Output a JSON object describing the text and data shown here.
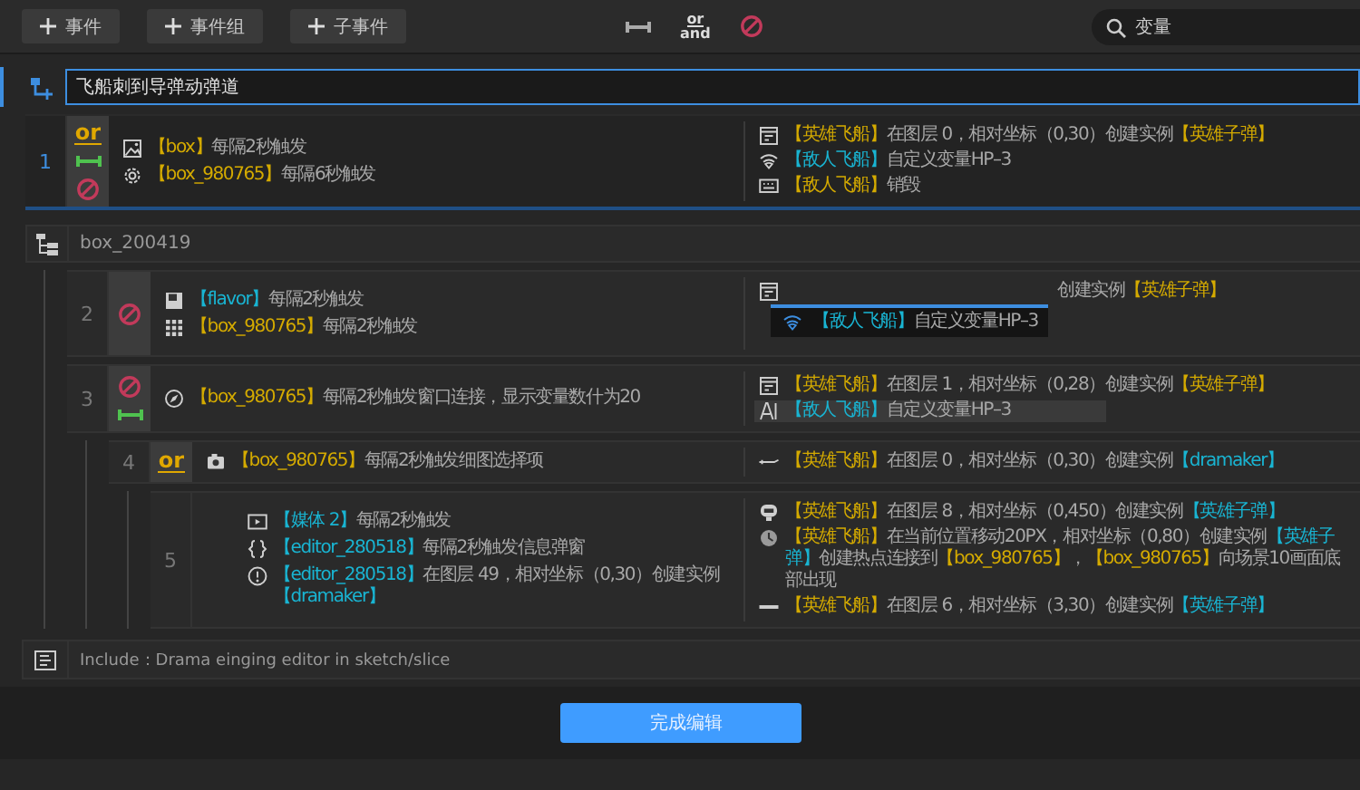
{
  "toolbar": {
    "buttons": [
      {
        "label": "事件"
      },
      {
        "label": "事件组"
      },
      {
        "label": "子事件"
      }
    ],
    "logic_label": "or",
    "logic_label_2": "and",
    "search": {
      "value": "变量"
    }
  },
  "title_field": {
    "value": "飞船刺到导弹动弹道"
  },
  "events": [
    {
      "number": "1",
      "selected": true,
      "markers": [
        {
          "kind": "or",
          "text": "or"
        },
        {
          "kind": "link"
        },
        {
          "kind": "disabled"
        }
      ],
      "conditions": [
        {
          "parts": [
            {
              "text": "【box】",
              "color": "#d4aa00"
            },
            {
              "text": "每隔2秒触发"
            }
          ]
        },
        {
          "parts": [
            {
              "text": "【box_980765】",
              "color": "#d4aa00"
            },
            {
              "text": "每隔6秒触发"
            }
          ]
        }
      ],
      "actions": [
        {
          "selected": false,
          "parts": [
            {
              "text": "【英雄飞船】",
              "color": "#d4aa00"
            },
            {
              "text": "在图层 0，相对坐标（0,30）创建实例"
            },
            {
              "text": "【英雄子弹】",
              "color": "#d4aa00"
            }
          ]
        },
        {
          "selected": false,
          "parts": [
            {
              "text": "【敌人飞船】",
              "color": "#19b4d2"
            },
            {
              "text": "自定义变量HP–3"
            }
          ]
        },
        {
          "selected": false,
          "parts": [
            {
              "text": "【敌人飞船】",
              "color": "#d4aa00"
            },
            {
              "text": "销毁"
            }
          ]
        }
      ]
    }
  ],
  "group": {
    "title": "box_200419",
    "children": [
      {
        "number": "2",
        "selected": false,
        "markers": [
          {
            "kind": "disabled"
          }
        ],
        "conditions": [
          {
            "parts": [
              {
                "text": "【flavor】",
                "color": "#19b4d2"
              },
              {
                "text": "每隔2秒触发"
              }
            ]
          },
          {
            "parts": [
              {
                "text": "【box_980765】",
                "color": "#d4aa00"
              },
              {
                "text": "每隔2秒触发"
              }
            ]
          }
        ],
        "actions": [
          {
            "selected": false,
            "parts": [
              {
                "text": "创建实例"
              },
              {
                "text": "【英雄子弹】",
                "color": "#d4aa00"
              }
            ]
          }
        ],
        "drag_ghost": {
          "parts": [
            {
              "text": "【敌人飞船】",
              "color": "#19b4d2"
            },
            {
              "text": "自定义变量HP–3"
            }
          ]
        }
      },
      {
        "number": "3",
        "selected": false,
        "markers": [
          {
            "kind": "disabled"
          },
          {
            "kind": "link"
          }
        ],
        "conditions": [
          {
            "parts": [
              {
                "text": "【box_980765】",
                "color": "#d4aa00"
              },
              {
                "text": "每隔2秒触发窗口连接，显示变量数什为20"
              }
            ]
          }
        ],
        "actions": [
          {
            "selected": false,
            "parts": [
              {
                "text": "【英雄飞船】",
                "color": "#d4aa00"
              },
              {
                "text": "在图层 1，相对坐标（0,28）创建实例"
              },
              {
                "text": "【英雄子弹】",
                "color": "#d4aa00"
              }
            ]
          },
          {
            "selected": true,
            "parts": [
              {
                "text": "【敌人飞船】",
                "color": "#19b4d2"
              },
              {
                "text": "自定义变量HP–3"
              }
            ]
          }
        ],
        "children": [
          {
            "number": "4",
            "selected": false,
            "markers": [
              {
                "kind": "or",
                "text": "or"
              }
            ],
            "conditions": [
              {
                "parts": [
                  {
                    "text": "【box_980765】",
                    "color": "#d4aa00"
                  },
                  {
                    "text": "每隔2秒触发细图选择项"
                  }
                ]
              }
            ],
            "actions": [
              {
                "selected": false,
                "parts": [
                  {
                    "text": "【英雄飞船】",
                    "color": "#d4aa00"
                  },
                  {
                    "text": "在图层 0，相对坐标（0,30）创建实例"
                  },
                  {
                    "text": "【dramaker】",
                    "color": "#19b4d2"
                  }
                ]
              }
            ],
            "children": [
              {
                "number": "5",
                "selected": false,
                "conditions": [
                  {
                    "parts": [
                      {
                        "text": "【媒体 2】",
                        "color": "#19b4d2"
                      },
                      {
                        "text": "每隔2秒触发"
                      }
                    ]
                  },
                  {
                    "parts": [
                      {
                        "text": "【editor_280518】",
                        "color": "#19b4d2"
                      },
                      {
                        "text": "每隔2秒触发信息弹窗"
                      }
                    ]
                  },
                  {
                    "parts": [
                      {
                        "text": "【editor_280518】",
                        "color": "#19b4d2"
                      },
                      {
                        "text": "在图层 49，相对坐标（0,30）创建实例"
                      },
                      {
                        "text": "【dramaker】",
                        "color": "#19b4d2"
                      }
                    ]
                  }
                ],
                "actions": [
                  {
                    "selected": false,
                    "parts": [
                      {
                        "text": "【英雄飞船】",
                        "color": "#d4aa00"
                      },
                      {
                        "text": "在图层 8，相对坐标（0,450）创建实例"
                      },
                      {
                        "text": "【英雄子弹】",
                        "color": "#19b4d2"
                      }
                    ]
                  },
                  {
                    "selected": false,
                    "parts": [
                      {
                        "text": "【英雄飞船】",
                        "color": "#d4aa00"
                      },
                      {
                        "text": "在当前位置移动20PX，相对坐标（0,80）创建实例"
                      },
                      {
                        "text": "【英雄子弹】",
                        "color": "#19b4d2"
                      },
                      {
                        "text": "创建热点连接到"
                      },
                      {
                        "text": "【box_980765】",
                        "color": "#d4aa00"
                      },
                      {
                        "text": "，"
                      },
                      {
                        "text": "【box_980765】",
                        "color": "#d4aa00"
                      },
                      {
                        "text": "向场景10画面底部出现"
                      }
                    ]
                  },
                  {
                    "selected": false,
                    "parts": [
                      {
                        "text": "【英雄飞船】",
                        "color": "#d4aa00"
                      },
                      {
                        "text": "在图层 6，相对坐标（3,30）创建实例"
                      },
                      {
                        "text": "【英雄子弹】",
                        "color": "#19b4d2"
                      }
                    ]
                  }
                ]
              }
            ]
          }
        ]
      }
    ]
  },
  "include": {
    "text": "Include：Drama einging editor in sketch/slice"
  },
  "footer": {
    "button": "完成编辑"
  }
}
